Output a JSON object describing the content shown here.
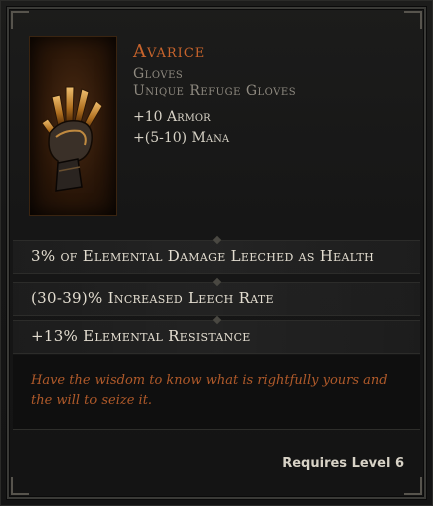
{
  "item": {
    "name": "Avarice",
    "base_type": "Gloves",
    "subtitle": "Unique Refuge Gloves",
    "icon": "gauntlet-icon",
    "stats": [
      "+10 Armor",
      "+(5-10) Mana"
    ]
  },
  "modifiers": [
    "3% of Elemental Damage Leeched as Health",
    "(30-39)% Increased Leech Rate",
    "+13% Elemental Resistance"
  ],
  "flavor_text": "Have the wisdom to know what is rightfully yours and the will to seize it.",
  "requirement": "Requires Level 6",
  "colors": {
    "name": "#c8642c",
    "subtitle": "#8f8a80",
    "stat": "#d7d2c6",
    "modifier": "#e3ddd0",
    "flavor": "#b05a2a"
  }
}
